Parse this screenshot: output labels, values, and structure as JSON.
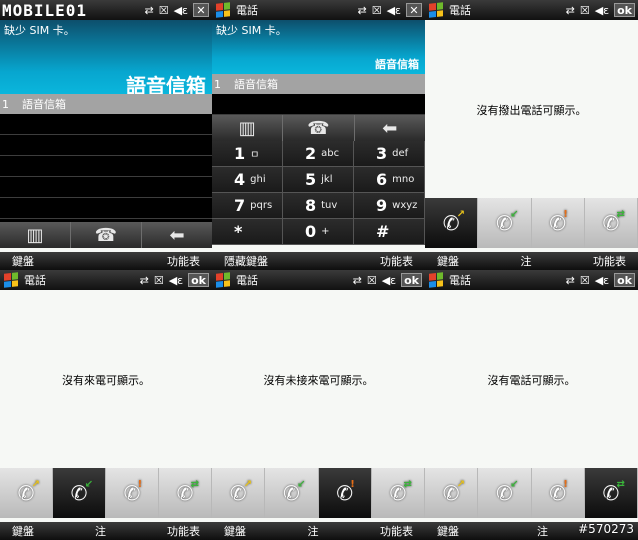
{
  "panels": {
    "voicemail": {
      "brand": "MOBILE01",
      "sim_missing": "缺少 SIM 卡。",
      "title": "語音信箱",
      "list_index": "1",
      "list_item": "語音信箱",
      "softkey_left": "鍵盤",
      "softkey_right": "功能表"
    },
    "keypad": {
      "status_title": "電話",
      "sim_missing": "缺少 SIM 卡。",
      "title": "語音信箱",
      "list_index": "1",
      "list_item": "語音信箱",
      "keys": [
        {
          "digit": "1",
          "letters": "ㅁ"
        },
        {
          "digit": "2",
          "letters": "abc"
        },
        {
          "digit": "3",
          "letters": "def"
        },
        {
          "digit": "4",
          "letters": "ghi"
        },
        {
          "digit": "5",
          "letters": "jkl"
        },
        {
          "digit": "6",
          "letters": "mno"
        },
        {
          "digit": "7",
          "letters": "pqrs"
        },
        {
          "digit": "8",
          "letters": "tuv"
        },
        {
          "digit": "9",
          "letters": "wxyz"
        },
        {
          "digit": "*",
          "letters": ""
        },
        {
          "digit": "0",
          "letters": "+"
        },
        {
          "digit": "#",
          "letters": ""
        }
      ],
      "softkey_left": "隱藏鍵盤",
      "softkey_right": "功能表"
    },
    "outgoing": {
      "status_title": "電話",
      "message": "沒有撥出電話可顯示。",
      "softkey_left": "鍵盤",
      "softkey_mid": "注",
      "softkey_right": "功能表"
    },
    "incoming": {
      "status_title": "電話",
      "message": "沒有來電可顯示。",
      "softkey_left": "鍵盤",
      "softkey_mid": "注",
      "softkey_right": "功能表"
    },
    "missed": {
      "status_title": "電話",
      "message": "沒有未接來電可顯示。",
      "softkey_left": "鍵盤",
      "softkey_mid": "注",
      "softkey_right": "功能表"
    },
    "all_calls": {
      "status_title": "電話",
      "message": "沒有電話可顯示。",
      "softkey_left": "鍵盤",
      "softkey_mid": "注",
      "softkey_right": ""
    }
  },
  "status_icons": {
    "x_label": "✕",
    "ok_label": "ok"
  },
  "tab_icons": [
    "outgoing-call-icon",
    "incoming-call-icon",
    "missed-call-icon",
    "all-calls-icon"
  ],
  "watermark": "#570273",
  "colors": {
    "voicemail_header": "#07a6cf",
    "list_row": "#a3a3a3",
    "tab_active": "#111111"
  }
}
